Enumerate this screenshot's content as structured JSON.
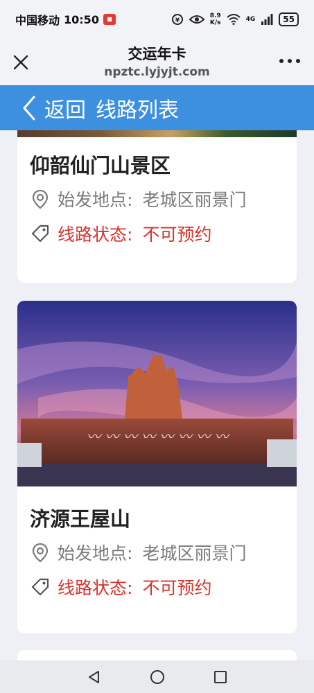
{
  "status_bar": {
    "carrier": "中国移动",
    "time": "10:50",
    "speed_value": "8.9",
    "speed_unit": "K/s",
    "signal_label": "4G",
    "battery": "55"
  },
  "header": {
    "title": "交运年卡",
    "url": "npztc.lyjyjt.com"
  },
  "nav": {
    "back_label": "返回",
    "title": "线路列表"
  },
  "routes": [
    {
      "name": "仰韶仙门山景区",
      "location_label": "始发地点:",
      "location": "老城区丽景门",
      "status_label": "线路状态:",
      "status": "不可预约"
    },
    {
      "name": "济源王屋山",
      "location_label": "始发地点:",
      "location": "老城区丽景门",
      "status_label": "线路状态:",
      "status": "不可预约"
    }
  ],
  "colors": {
    "nav_blue": "#3d8fe0",
    "status_red": "#d9322b",
    "muted_gray": "#7a7a7a"
  },
  "icons": [
    "close-icon",
    "more-icon",
    "back-chevron-icon",
    "location-pin-icon",
    "tag-icon",
    "nav-back-icon",
    "nav-home-icon",
    "nav-recents-icon"
  ]
}
